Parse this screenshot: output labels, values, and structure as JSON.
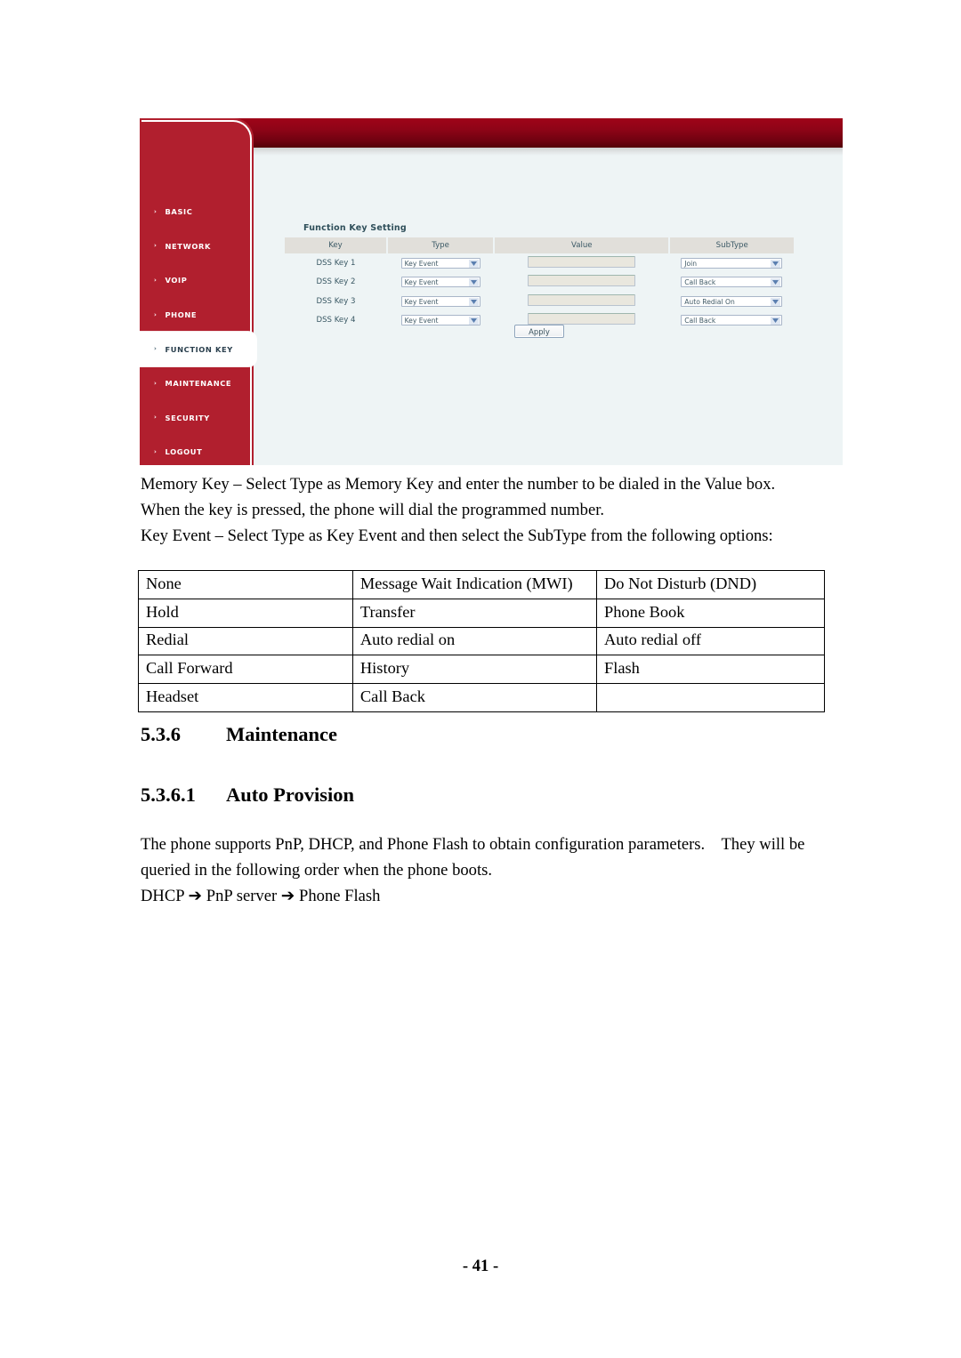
{
  "webui": {
    "sidebar": {
      "items": [
        {
          "label": "BASIC",
          "active": false
        },
        {
          "label": "NETWORK",
          "active": false
        },
        {
          "label": "VOIP",
          "active": false
        },
        {
          "label": "PHONE",
          "active": false
        },
        {
          "label": "FUNCTION KEY",
          "active": true
        },
        {
          "label": "MAINTENANCE",
          "active": false
        },
        {
          "label": "SECURITY",
          "active": false
        },
        {
          "label": "LOGOUT",
          "active": false
        }
      ],
      "chevron": "›"
    },
    "panel": {
      "title": "Function Key Setting",
      "columns": [
        "Key",
        "Type",
        "Value",
        "SubType"
      ],
      "rows": [
        {
          "key": "DSS Key 1",
          "type": "Key Event",
          "value": "",
          "subtype": "Join"
        },
        {
          "key": "DSS Key 2",
          "type": "Key Event",
          "value": "",
          "subtype": "Call Back"
        },
        {
          "key": "DSS Key 3",
          "type": "Key Event",
          "value": "",
          "subtype": "Auto Redial On"
        },
        {
          "key": "DSS Key 4",
          "type": "Key Event",
          "value": "",
          "subtype": "Call Back"
        }
      ],
      "apply_label": "Apply"
    },
    "colors": {
      "sidebar_red": "#b11f2e",
      "banner_red": "#8e0417",
      "content_bg": "#eef4f5",
      "table_header_bg": "#e1dfda",
      "value_input_bg": "#e9e7de",
      "panel_title_color": "#2f4f5a"
    }
  },
  "document": {
    "paragraphs": {
      "memory_key": "Memory Key – Select Type as Memory Key and enter the number to be dialed in the Value box.    When the key is pressed, the phone will dial the programmed number.",
      "key_event": "Key Event – Select Type as Key Event and then select the SubType from the following options:",
      "auto_provision": "The phone supports PnP, DHCP, and Phone Flash to obtain configuration parameters.    They will be queried in the following order when the phone boots.",
      "boot_order": "DHCP ➔ PnP server ➔ Phone Flash"
    },
    "options_table": {
      "rows": [
        [
          "None",
          "Message Wait Indication (MWI)",
          "Do Not Disturb (DND)"
        ],
        [
          "Hold",
          "Transfer",
          "Phone Book"
        ],
        [
          "Redial",
          "Auto redial on",
          "Auto redial off"
        ],
        [
          "Call Forward",
          "History",
          "Flash"
        ],
        [
          "Headset",
          "Call Back",
          ""
        ]
      ]
    },
    "headings": {
      "maintenance_num": "5.3.6",
      "maintenance_title": "Maintenance",
      "autoprovision_num": "5.3.6.1",
      "autoprovision_title": "Auto Provision"
    },
    "footer": "- 41 -"
  }
}
